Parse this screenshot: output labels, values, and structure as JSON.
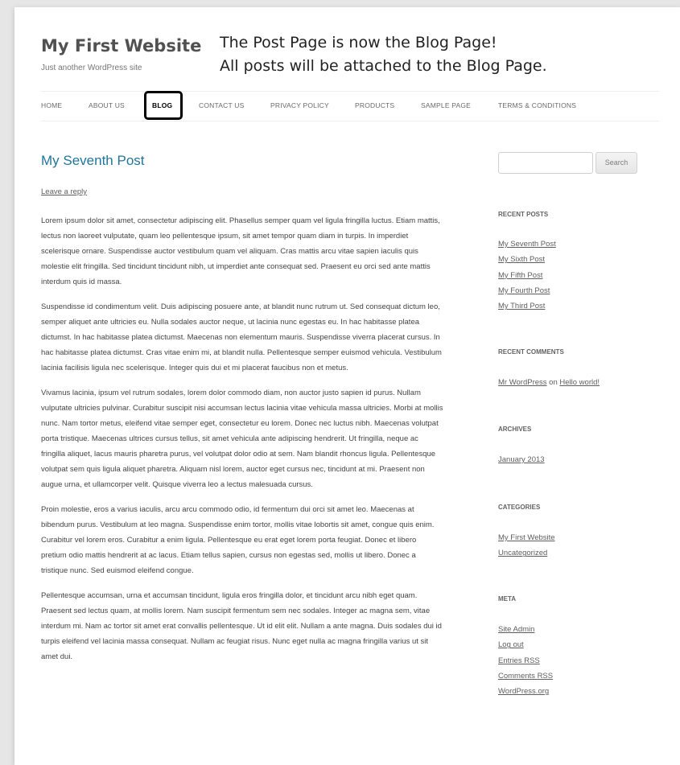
{
  "site": {
    "title": "My First Website",
    "tagline": "Just another WordPress site"
  },
  "annotation": {
    "line1": "The Post Page is now the Blog Page!",
    "line2": "All posts will be attached to the Blog Page."
  },
  "nav": {
    "items": [
      {
        "label": "HOME"
      },
      {
        "label": "ABOUT US"
      },
      {
        "label": "BLOG"
      },
      {
        "label": "CONTACT US"
      },
      {
        "label": "PRIVACY POLICY"
      },
      {
        "label": "PRODUCTS"
      },
      {
        "label": "SAMPLE PAGE"
      },
      {
        "label": "TERMS & CONDITIONS"
      }
    ]
  },
  "post": {
    "title": "My Seventh Post",
    "leave_reply": "Leave a reply",
    "paragraphs": [
      "Lorem ipsum dolor sit amet, consectetur adipiscing elit. Phasellus semper quam vel ligula fringilla luctus. Etiam mattis, lectus non laoreet vulputate, quam leo pellentesque ipsum, sit amet tempor quam diam in turpis. In imperdiet scelerisque ornare. Suspendisse auctor vestibulum quam vel aliquam. Cras mattis arcu vitae sapien iaculis quis molestie elit fringilla. Sed tincidunt tincidunt nibh, ut imperdiet ante consequat sed. Praesent eu orci sed ante mattis interdum quis id massa.",
      "Suspendisse id condimentum velit. Duis adipiscing posuere ante, at blandit nunc rutrum ut. Sed consequat dictum leo, semper aliquet ante ultricies eu. Nulla sodales auctor neque, ut lacinia nunc egestas eu. In hac habitasse platea dictumst. In hac habitasse platea dictumst. Maecenas non elementum mauris. Suspendisse viverra placerat cursus. In hac habitasse platea dictumst. Cras vitae enim mi, at blandit nulla. Pellentesque semper euismod vehicula. Vestibulum lacinia facilisis ligula nec scelerisque. Integer quis dui et mi placerat faucibus non et metus.",
      "Vivamus lacinia, ipsum vel rutrum sodales, lorem dolor commodo diam, non auctor justo sapien id purus. Nullam vulputate ultricies pulvinar. Curabitur suscipit nisi accumsan lectus lacinia vitae vehicula massa ultricies. Morbi at mollis nunc. Nam tortor metus, eleifend vitae semper eget, consectetur eu lorem. Donec nec luctus nibh. Maecenas volutpat porta tristique. Maecenas ultrices cursus tellus, sit amet vehicula ante adipiscing hendrerit. Ut fringilla, neque ac fringilla aliquet, lacus mauris pharetra purus, vel volutpat dolor odio at sem. Nam blandit rhoncus ligula. Pellentesque volutpat sem quis ligula aliquet pharetra. Aliquam nisl lorem, auctor eget cursus nec, tincidunt at mi. Praesent non augue urna, et ullamcorper velit. Quisque viverra leo a lectus malesuada cursus.",
      "Proin molestie, eros a varius iaculis, arcu arcu commodo odio, id fermentum dui orci sit amet leo. Maecenas at bibendum purus. Vestibulum at leo magna. Suspendisse enim tortor, mollis vitae lobortis sit amet, congue quis enim. Curabitur vel lorem eros. Curabitur a enim ligula. Pellentesque eu erat eget lorem porta feugiat. Donec et libero pretium odio mattis hendrerit at ac lacus. Etiam tellus sapien, cursus non egestas sed, mollis ut libero. Donec a tristique nunc. Sed euismod eleifend congue.",
      "Pellentesque accumsan, urna et accumsan tincidunt, ligula eros fringilla dolor, et tincidunt arcu nibh eget quam. Praesent sed lectus quam, at mollis lorem. Nam suscipit fermentum sem nec sodales. Integer ac magna sem, vitae interdum mi. Nam ac tortor sit amet erat convallis pellentesque. Ut id elit elit. Nullam a ante magna. Duis sodales dui id turpis eleifend vel lacinia massa consequat. Nullam ac feugiat risus. Nunc eget nulla ac magna fringilla varius ut sit amet dui."
    ]
  },
  "sidebar": {
    "search_button": "Search",
    "recent_posts": {
      "title": "RECENT POSTS",
      "items": [
        "My Seventh Post",
        "My Sixth Post",
        "My Fifth Post",
        "My Fourth Post",
        "My Third Post"
      ]
    },
    "recent_comments": {
      "title": "RECENT COMMENTS",
      "author": "Mr WordPress",
      "on": "on",
      "post": "Hello world!"
    },
    "archives": {
      "title": "ARCHIVES",
      "items": [
        "January 2013"
      ]
    },
    "categories": {
      "title": "CATEGORIES",
      "items": [
        "My First Website",
        "Uncategorized"
      ]
    },
    "meta": {
      "title": "META",
      "items": [
        "Site Admin",
        "Log out",
        "Entries RSS",
        "Comments RSS",
        "WordPress.org"
      ]
    }
  }
}
